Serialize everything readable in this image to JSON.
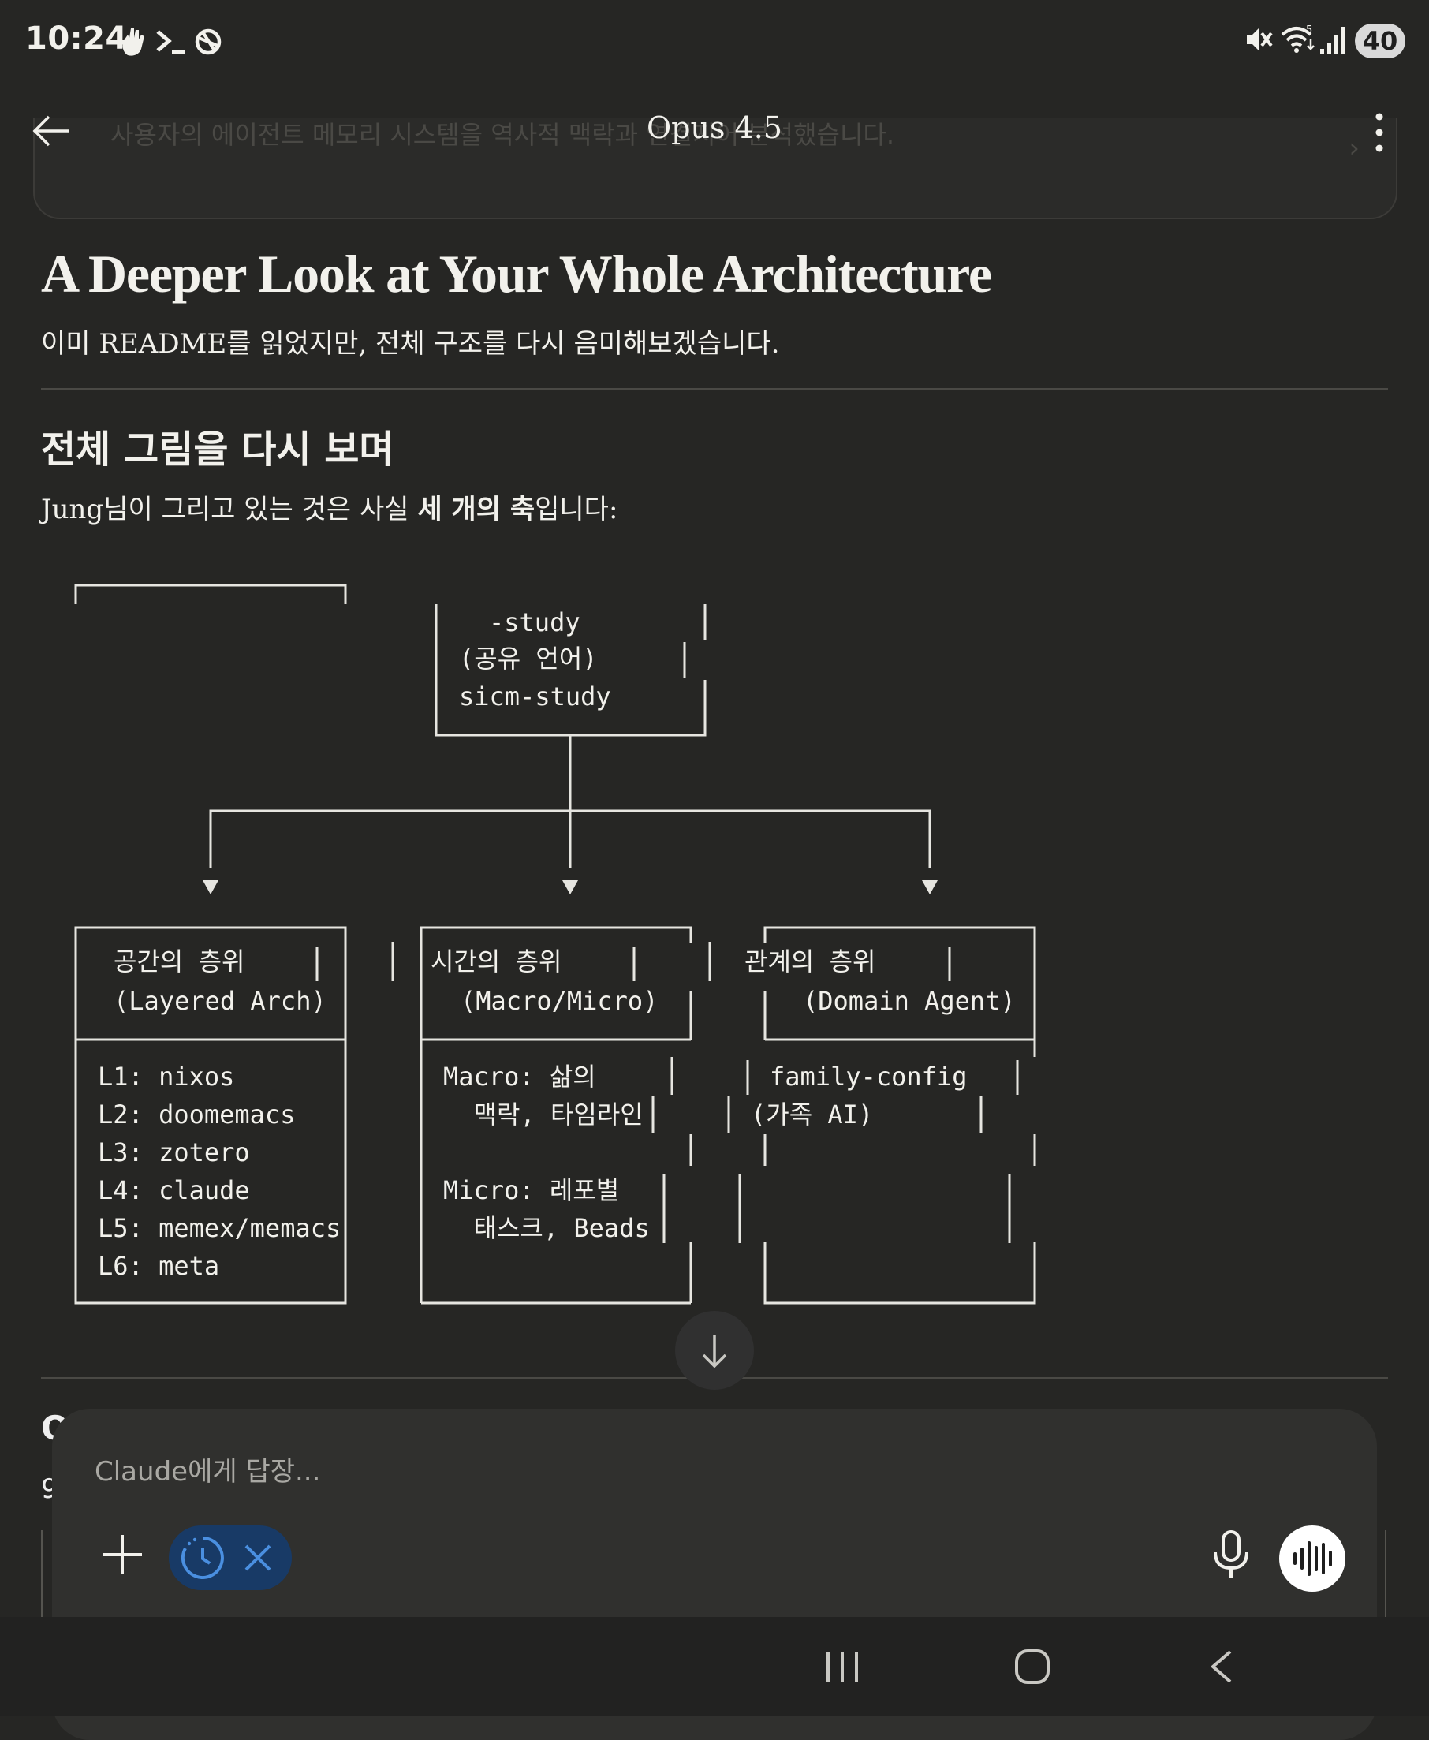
{
  "status_bar": {
    "time": "10:24",
    "battery": "40"
  },
  "header": {
    "title": "Opus 4.5"
  },
  "previous_card": {
    "text": "사용자의 에이전트 메모리 시스템을 역사적 맥락과 연결지어 분석했습니다."
  },
  "content": {
    "heading": "A Deeper Look at Your Whole Architecture",
    "intro": "이미 README를 읽었지만, 전체 구조를 다시 음미해보겠습니다.",
    "section_heading": "전체 그림을 다시 보며",
    "section_text_prefix": "Jung님이 그리고 있는 것은 사실 ",
    "section_text_bold": "세 개의 축",
    "section_text_suffix": "입니다:"
  },
  "diagram": {
    "top_box": [
      "-study",
      "(공유 언어)",
      "sicm-study"
    ],
    "boxes": [
      {
        "title": "공간의 층위",
        "subtitle": "(Layered Arch)",
        "lines": [
          "L1: nixos",
          "L2: doomemacs",
          "L3: zotero",
          "L4: claude",
          "L5: memex/memacs",
          "L6: meta"
        ]
      },
      {
        "title": "시간의 층위",
        "subtitle": "(Macro/Micro)",
        "lines": [
          "Macro: 삶의",
          "  맥락, 타임라인",
          "",
          "Micro: 레포별",
          "  태스크, Beads"
        ]
      },
      {
        "title": "관계의 층위",
        "subtitle": "(Domain Agent)",
        "lines": [
          "family-config",
          "(가족 AI)"
        ]
      }
    ]
  },
  "below_input": {
    "heading_fragment": "O'",
    "text_fragment": "9"
  },
  "input": {
    "placeholder": "Claude에게 답장..."
  },
  "colors": {
    "background": "#262624",
    "input_panel": "#30302e",
    "chip": "#183a66",
    "chip_accent": "#4a8fe0"
  }
}
